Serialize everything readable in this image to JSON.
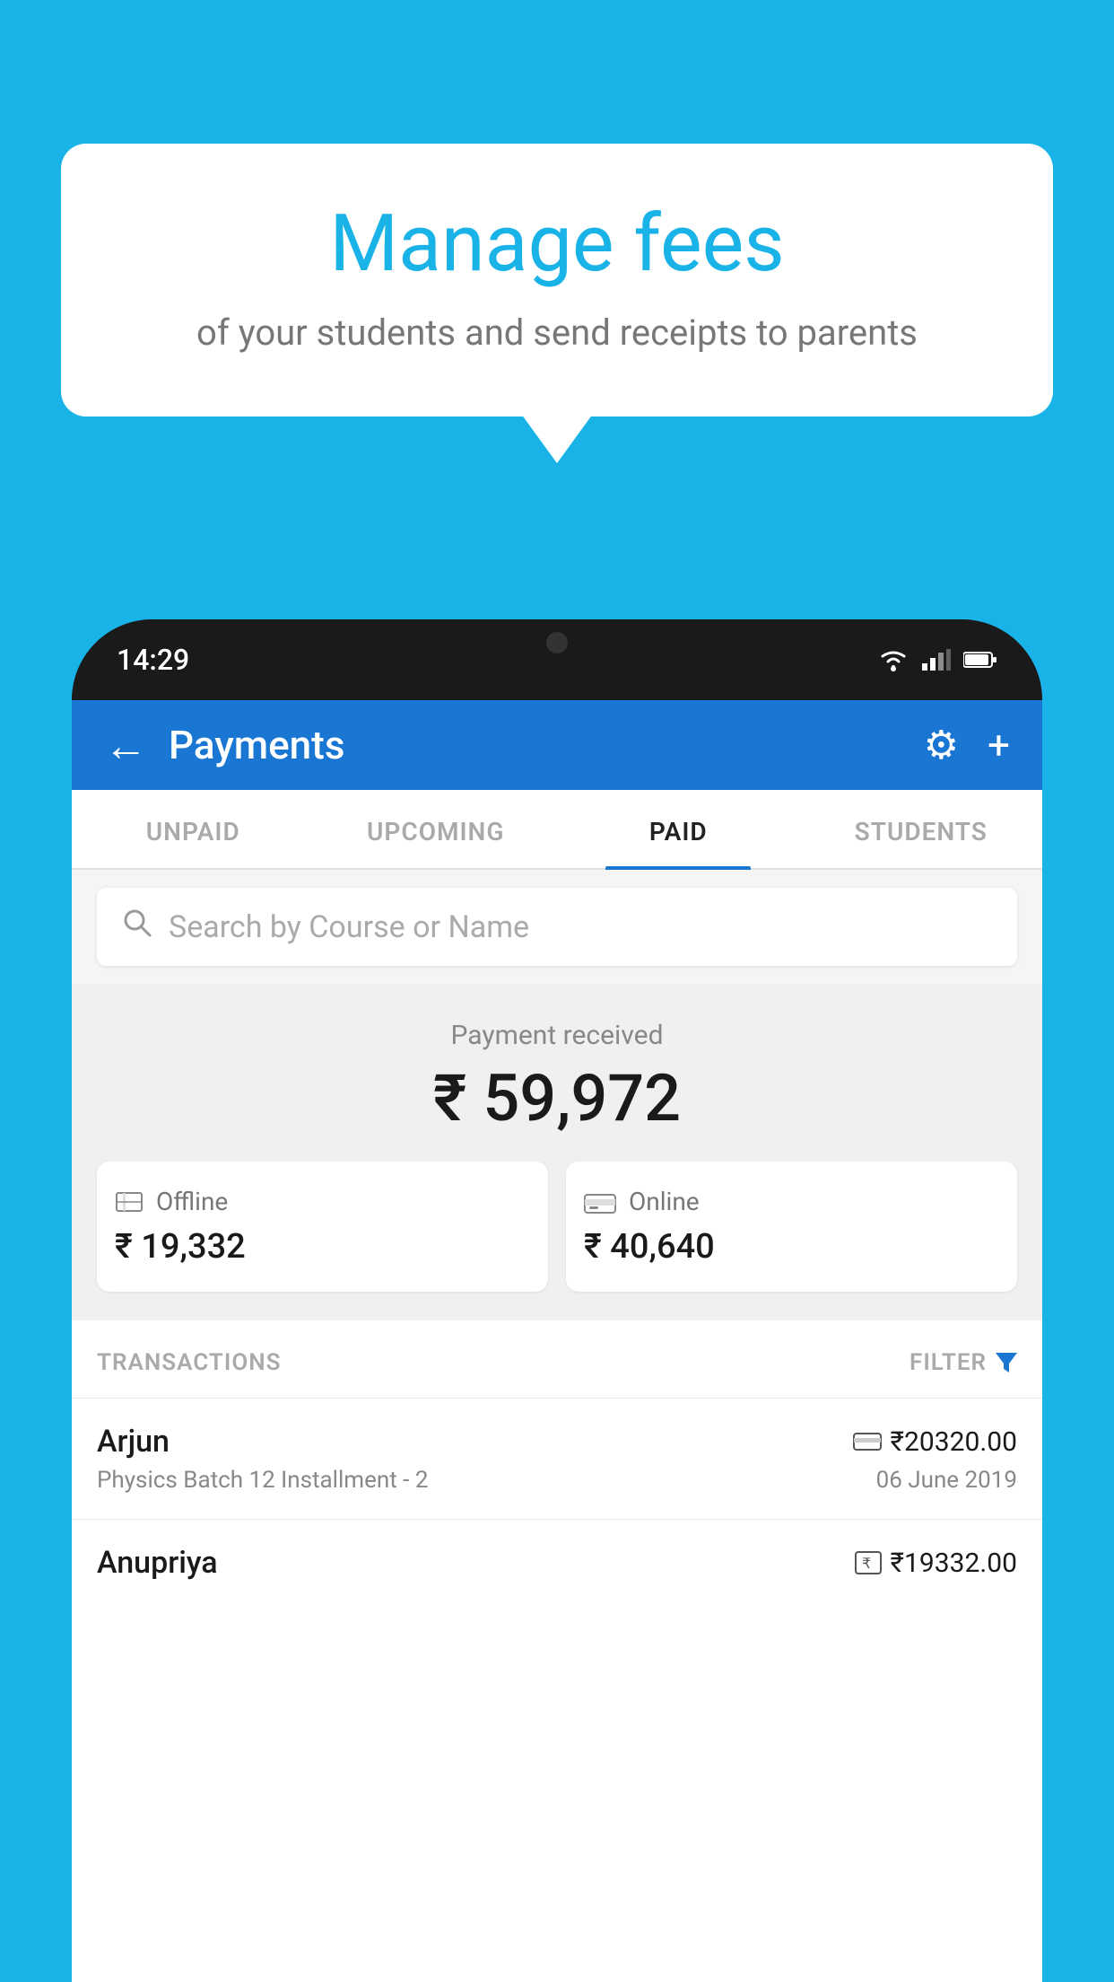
{
  "background": {
    "color": "#1ab3e8"
  },
  "speech_bubble": {
    "title": "Manage fees",
    "subtitle": "of your students and send receipts to parents"
  },
  "phone": {
    "status_bar": {
      "time": "14:29"
    },
    "header": {
      "title": "Payments",
      "back_label": "←",
      "gear_icon": "⚙",
      "plus_icon": "+"
    },
    "tabs": [
      {
        "label": "UNPAID",
        "active": false
      },
      {
        "label": "UPCOMING",
        "active": false
      },
      {
        "label": "PAID",
        "active": true
      },
      {
        "label": "STUDENTS",
        "active": false
      }
    ],
    "search": {
      "placeholder": "Search by Course or Name"
    },
    "summary": {
      "label": "Payment received",
      "amount": "₹ 59,972",
      "offline": {
        "label": "Offline",
        "amount": "₹ 19,332"
      },
      "online": {
        "label": "Online",
        "amount": "₹ 40,640"
      }
    },
    "transactions": {
      "header_label": "TRANSACTIONS",
      "filter_label": "FILTER",
      "rows": [
        {
          "name": "Arjun",
          "amount": "₹20320.00",
          "course": "Physics Batch 12 Installment - 2",
          "date": "06 June 2019",
          "payment_type": "online"
        },
        {
          "name": "Anupriya",
          "amount": "₹19332.00",
          "course": "",
          "date": "",
          "payment_type": "offline"
        }
      ]
    }
  }
}
